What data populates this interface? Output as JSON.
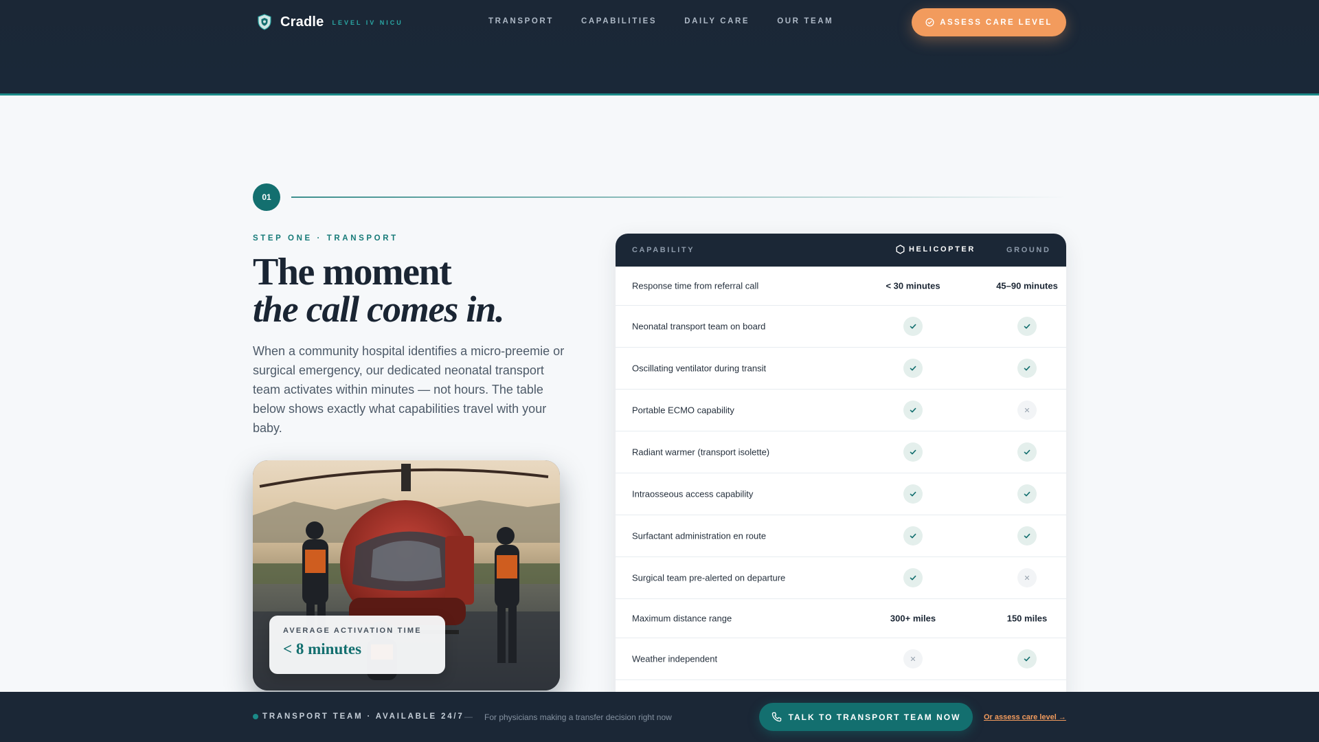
{
  "brand": {
    "name": "Cradle",
    "tag": "LEVEL IV NICU"
  },
  "nav": {
    "items": [
      {
        "label": "TRANSPORT"
      },
      {
        "label": "CAPABILITIES"
      },
      {
        "label": "DAILY CARE"
      },
      {
        "label": "OUR TEAM"
      }
    ],
    "cta_label": "ASSESS CARE LEVEL"
  },
  "step": {
    "number": "01",
    "eyebrow": "STEP ONE · TRANSPORT",
    "headline_line1": "The moment",
    "headline_line2": "the call comes in.",
    "lede": "When a community hospital identifies a micro-preemie or surgical emergency, our dedicated neonatal transport team activates within minutes — not hours. The table below shows exactly what capabilities travel with your baby."
  },
  "stat": {
    "label": "AVERAGE ACTIVATION TIME",
    "value": "< 8 minutes"
  },
  "table": {
    "headers": {
      "capability": "CAPABILITY",
      "helicopter": "HELICOPTER",
      "ground": "GROUND"
    },
    "rows": [
      {
        "capability": "Response time from referral call",
        "type": "text",
        "helicopter": "< 30 minutes",
        "ground": "45–90 minutes"
      },
      {
        "capability": "Neonatal transport team on board",
        "type": "bool",
        "helicopter": true,
        "ground": true
      },
      {
        "capability": "Oscillating ventilator during transit",
        "type": "bool",
        "helicopter": true,
        "ground": true
      },
      {
        "capability": "Portable ECMO capability",
        "type": "bool",
        "helicopter": true,
        "ground": false
      },
      {
        "capability": "Radiant warmer (transport isolette)",
        "type": "bool",
        "helicopter": true,
        "ground": true
      },
      {
        "capability": "Intraosseous access capability",
        "type": "bool",
        "helicopter": true,
        "ground": true
      },
      {
        "capability": "Surfactant administration en route",
        "type": "bool",
        "helicopter": true,
        "ground": true
      },
      {
        "capability": "Surgical team pre-alerted on departure",
        "type": "bool",
        "helicopter": true,
        "ground": false
      },
      {
        "capability": "Maximum distance range",
        "type": "text",
        "helicopter": "300+ miles",
        "ground": "150 miles"
      },
      {
        "capability": "Weather independent",
        "type": "bool",
        "helicopter": false,
        "ground": true
      }
    ]
  },
  "bottom_bar": {
    "title": "TRANSPORT TEAM · AVAILABLE 24/7",
    "dash": "—",
    "subtitle": "For physicians making a transfer decision right now",
    "cta_label": "TALK TO TRANSPORT TEAM NOW",
    "link_label": "Or assess care level →"
  },
  "colors": {
    "navy": "#1b2736",
    "teal": "#136f6f",
    "orange": "#f29b5d",
    "background": "#f6f8fa"
  },
  "icons": {
    "brand": "shield-icon",
    "cta": "check-circle-icon",
    "helicopter_header": "hexagon-icon",
    "yes": "check-icon",
    "no": "x-icon",
    "phone": "phone-icon"
  }
}
